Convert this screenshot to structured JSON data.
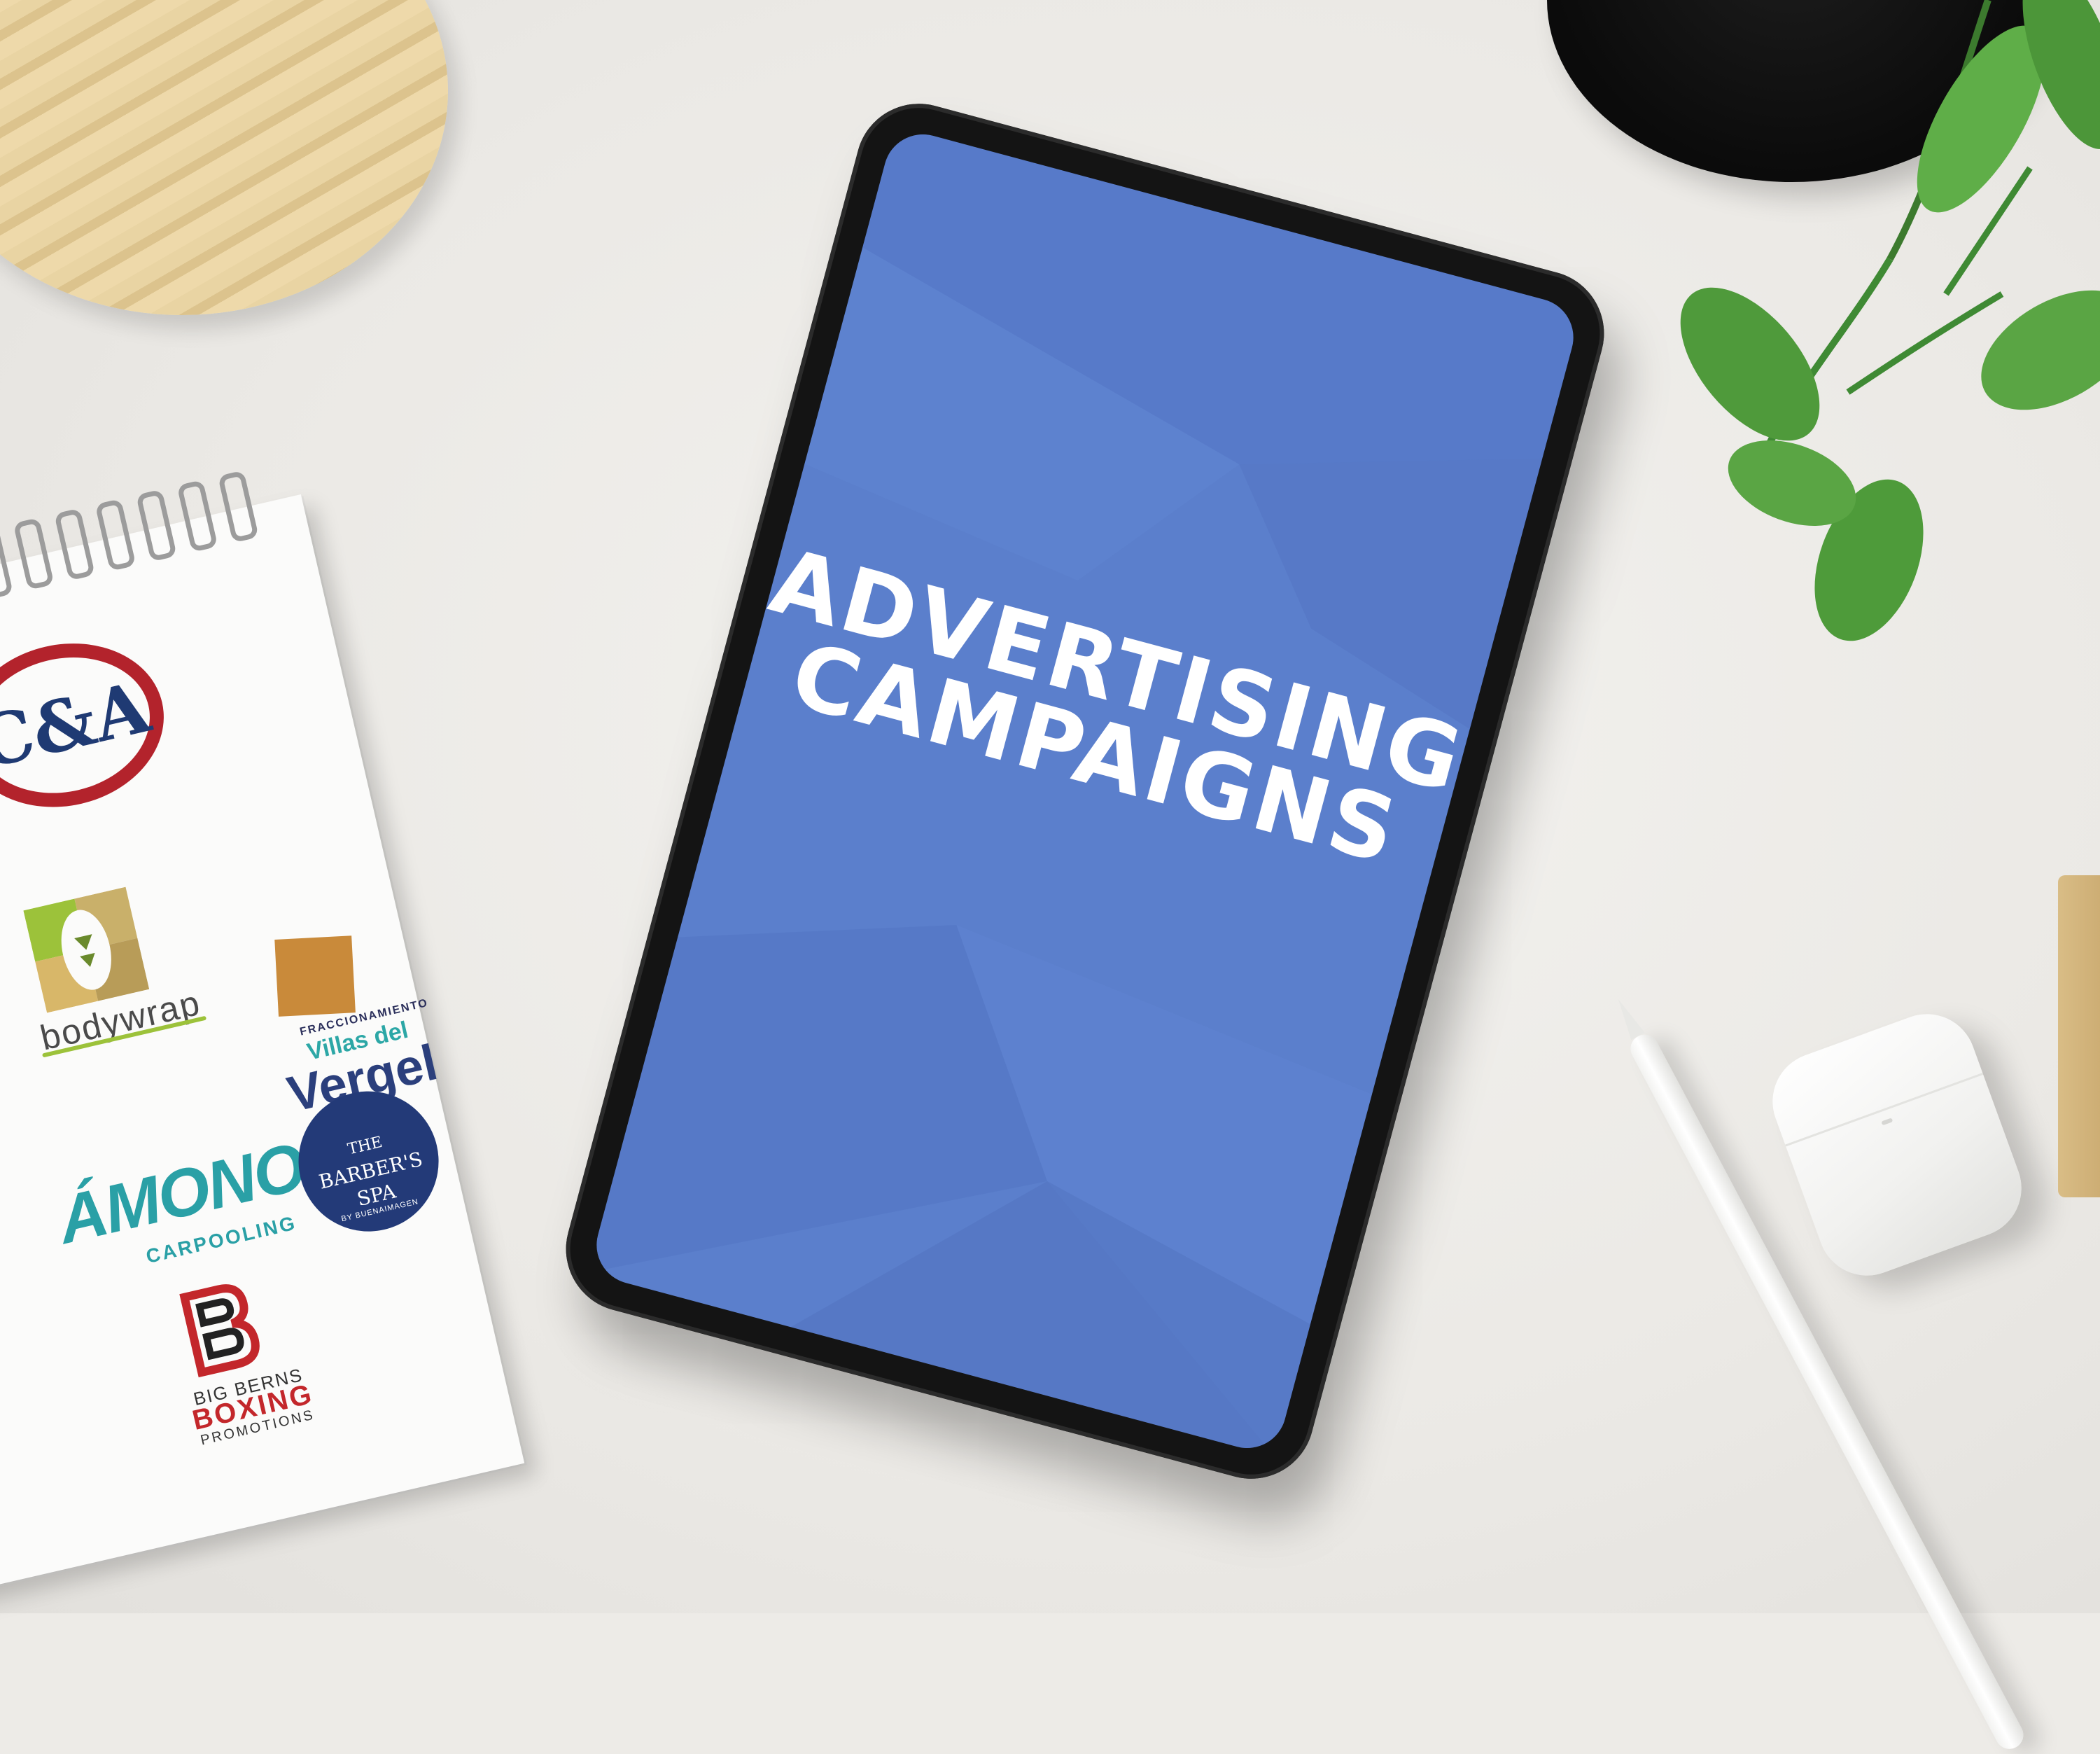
{
  "tablet": {
    "headline_line1": "ADVERTISING",
    "headline_line2": "CAMPAIGNS",
    "screen_color": "#5b7fcc"
  },
  "notepad": {
    "logos": {
      "ca": "C&A",
      "bodywrap": "bodywrap",
      "villas_del_vergel": {
        "top": "FRACCIONAMIENTO",
        "middle": "Villas del",
        "bottom": "Vergel"
      },
      "amonos": {
        "word": "ÁMONOS",
        "sub": "CARPOOLING"
      },
      "barbers_spa": {
        "line1": "THE",
        "line2": "BARBER'S",
        "line3": "SPA",
        "tagline": "BY BUENAIMAGEN"
      },
      "big_berns": {
        "line1": "BIG BERNS",
        "line2": "BOXING",
        "line3": "PROMOTIONS"
      }
    }
  },
  "colors": {
    "desk": "#edebe7",
    "ca_red": "#b3232c",
    "ca_blue": "#1f3a73",
    "teal": "#2aa0a6",
    "navy": "#2b3f7c",
    "boxing_red": "#c3272b"
  }
}
